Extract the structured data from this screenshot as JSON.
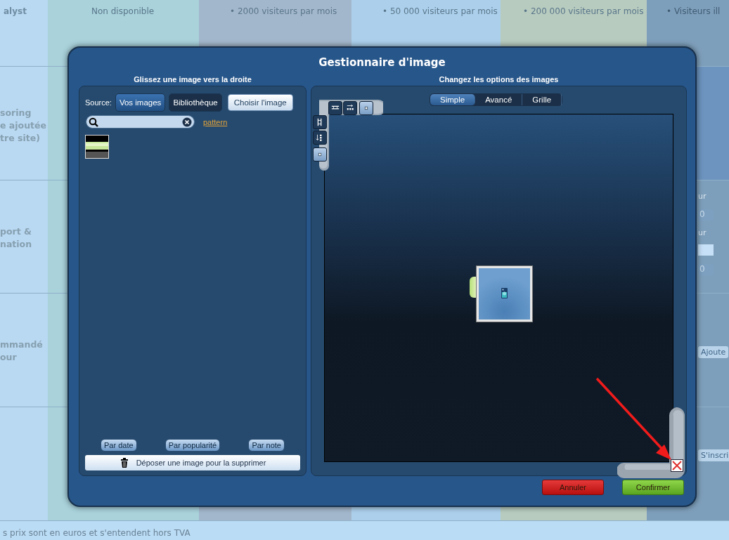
{
  "background": {
    "columns": [
      {
        "header": [
          "alyst"
        ]
      },
      {
        "header": [
          "Non disponible"
        ]
      },
      {
        "header": [
          "• 2000 visiteurs par mois"
        ]
      },
      {
        "header": [
          "• 50 000 visiteurs par mois"
        ]
      },
      {
        "header": [
          "• 200 000 visiteurs par mois"
        ]
      },
      {
        "header": [
          "• Visiteurs ill"
        ]
      }
    ],
    "row_labels": [
      [
        "soring",
        "e ajoutée",
        "tre site)"
      ],
      [
        "port &",
        "nation"
      ],
      [
        "mmandé",
        "our"
      ]
    ],
    "side_fragments": [
      {
        "kind": "label",
        "text": "ur"
      },
      {
        "kind": "spinner",
        "text": "0"
      },
      {
        "kind": "label",
        "text": "ur"
      },
      {
        "kind": "field"
      },
      {
        "kind": "spinner",
        "text": "0"
      },
      {
        "kind": "button",
        "text": "Ajoute"
      },
      {
        "kind": "button",
        "text": "S'inscri"
      }
    ],
    "footer_note": "s prix sont en euros et s'entendent hors TVA"
  },
  "dialog": {
    "title": "Gestionnaire d'image",
    "left_panel": {
      "heading": "Glissez une image vers la droite",
      "source_label": "Source:",
      "sources": [
        {
          "label": "Vos images",
          "selected": true
        },
        {
          "label": "Bibliothèque",
          "selected": false
        }
      ],
      "choose_button": "Choisir l'image",
      "filter_link": "pattern",
      "sort_buttons": [
        "Par date",
        "Par popularité",
        "Par note"
      ],
      "delete_drop": "Déposer une image pour la supprimer"
    },
    "right_panel": {
      "heading": "Changez les options des images",
      "modes": [
        {
          "label": "Simple",
          "selected": true
        },
        {
          "label": "Avancé",
          "selected": false
        },
        {
          "label": "Grille",
          "selected": false
        }
      ]
    },
    "buttons": [
      {
        "label": "Annuler",
        "kind": "cancel"
      },
      {
        "label": "Confirmer",
        "kind": "confirm"
      }
    ]
  }
}
